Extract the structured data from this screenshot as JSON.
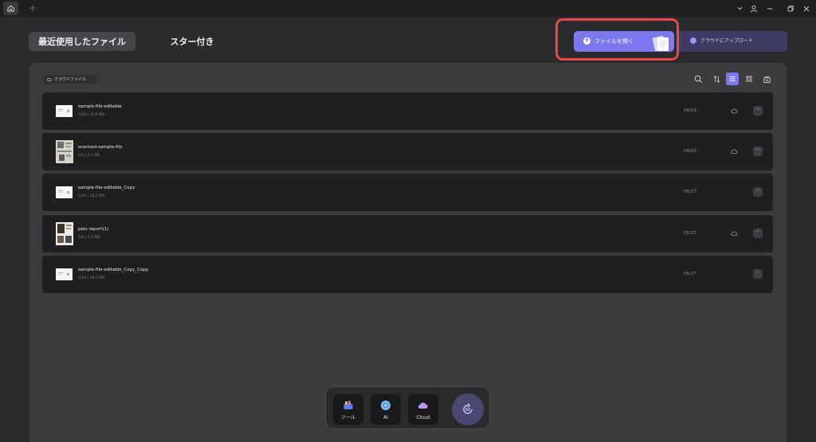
{
  "titlebar": {
    "new_tab": "+"
  },
  "tabs": {
    "recent": "最近使用したファイル",
    "starred": "スター付き"
  },
  "actions": {
    "open_file": "ファイルを開く",
    "upload_cloud": "クラウドにアップロード"
  },
  "toolbar": {
    "cloud_files": "クラウドファイル"
  },
  "files": [
    {
      "name": "sample-file-editable",
      "meta": "1/28 | 16.6 MB",
      "date": "06/03",
      "cloud": true
    },
    {
      "name": "scanned-sample-file",
      "meta": "1/3 | 2.2 MB",
      "date": "06/03",
      "cloud": true
    },
    {
      "name": "sample-file-editable_Copy",
      "meta": "1/28 | 18.2 MB",
      "date": "05/27",
      "cloud": false
    },
    {
      "name": "pets report(1)",
      "meta": "1/8 | 3.8 MB",
      "date": "05/27",
      "cloud": true
    },
    {
      "name": "sample-file-editable_Copy_Copy",
      "meta": "1/28 | 18.3 MB",
      "date": "05/27",
      "cloud": false
    }
  ],
  "more_label": "···",
  "dock": {
    "tools": "ツール",
    "ai": "AI",
    "cloud": "Cloud"
  },
  "colors": {
    "accent": "#7d78ee",
    "highlight": "#e8474c",
    "row_bg": "#1f1f21"
  }
}
